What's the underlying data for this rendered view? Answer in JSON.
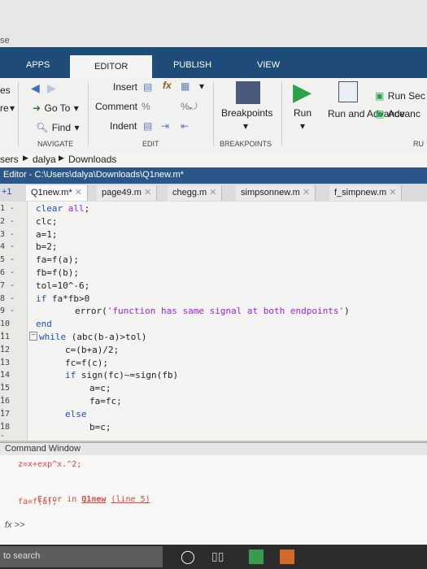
{
  "window": {
    "title_fragment": "se"
  },
  "ribbon_tabs": [
    "APPS",
    "EDITOR",
    "PUBLISH",
    "VIEW"
  ],
  "ribbon": {
    "left_cut_top": "es",
    "left_cut_mid": "re",
    "insert": "Insert",
    "fx": "fx",
    "go_to": "Go To",
    "comment": "Comment",
    "find": "Find",
    "indent": "Indent",
    "breakpoints": "Breakpoints",
    "run": "Run",
    "run_and_advance": "Run and Advance",
    "run_section": "Run Sec",
    "advance": "Advanc",
    "groups": {
      "navigate": "NAVIGATE",
      "edit": "EDIT",
      "breakpoints": "BREAKPOINTS",
      "run_cut": "RU"
    }
  },
  "breadcrumb": [
    "sers",
    "dalya",
    "Downloads"
  ],
  "editor_title": "Editor - C:\\Users\\dalya\\Downloads\\Q1new.m*",
  "editor_tabs": [
    "Q1new.m*",
    "page49.m",
    "chegg.m",
    "simpsonnew.m",
    "f_simpnew.m"
  ],
  "tab_prefix": "+1",
  "code_lines": [
    {
      "n": "1 -",
      "t": "clear all;"
    },
    {
      "n": "2 -",
      "t": "clc;"
    },
    {
      "n": "3 -",
      "t": "a=1;"
    },
    {
      "n": "4 -",
      "t": "b=2;"
    },
    {
      "n": "5 -",
      "t": "fa=f(a);"
    },
    {
      "n": "6 -",
      "t": "fb=f(b);"
    },
    {
      "n": "7 -",
      "t": "tol=10^-6;"
    },
    {
      "n": "8 -",
      "t": "if fa*fb>0"
    },
    {
      "n": "9 -",
      "t": "error('function has same signal at both endpoints')"
    },
    {
      "n": "10 -",
      "t": "end"
    },
    {
      "n": "11 -",
      "t": "while (abc(b-a)>tol)"
    },
    {
      "n": "12 -",
      "t": "c=(b+a)/2;"
    },
    {
      "n": "13 -",
      "t": "fc=f(c);"
    },
    {
      "n": "14 -",
      "t": "if sign(fc)~=sign(fb)"
    },
    {
      "n": "15 -",
      "t": "a=c;"
    },
    {
      "n": "16 -",
      "t": "fa=fc;"
    },
    {
      "n": "17 -",
      "t": "else"
    },
    {
      "n": "18 -",
      "t": "b=c;"
    }
  ],
  "command_window": {
    "title": "Command Window",
    "line1": "z=x+exp^x.^2;",
    "error_prefix": "Error in ",
    "error_link": "Q1new",
    "error_loc": "(line 5)",
    "error_code": "fa=f(a);",
    "prompt": "fx >>"
  },
  "taskbar": {
    "search": "to search"
  },
  "colors": {
    "ribbon_blue": "#1e4b78",
    "keyword": "#1d4fc7",
    "string": "#a020f0",
    "error": "#e2453c"
  }
}
